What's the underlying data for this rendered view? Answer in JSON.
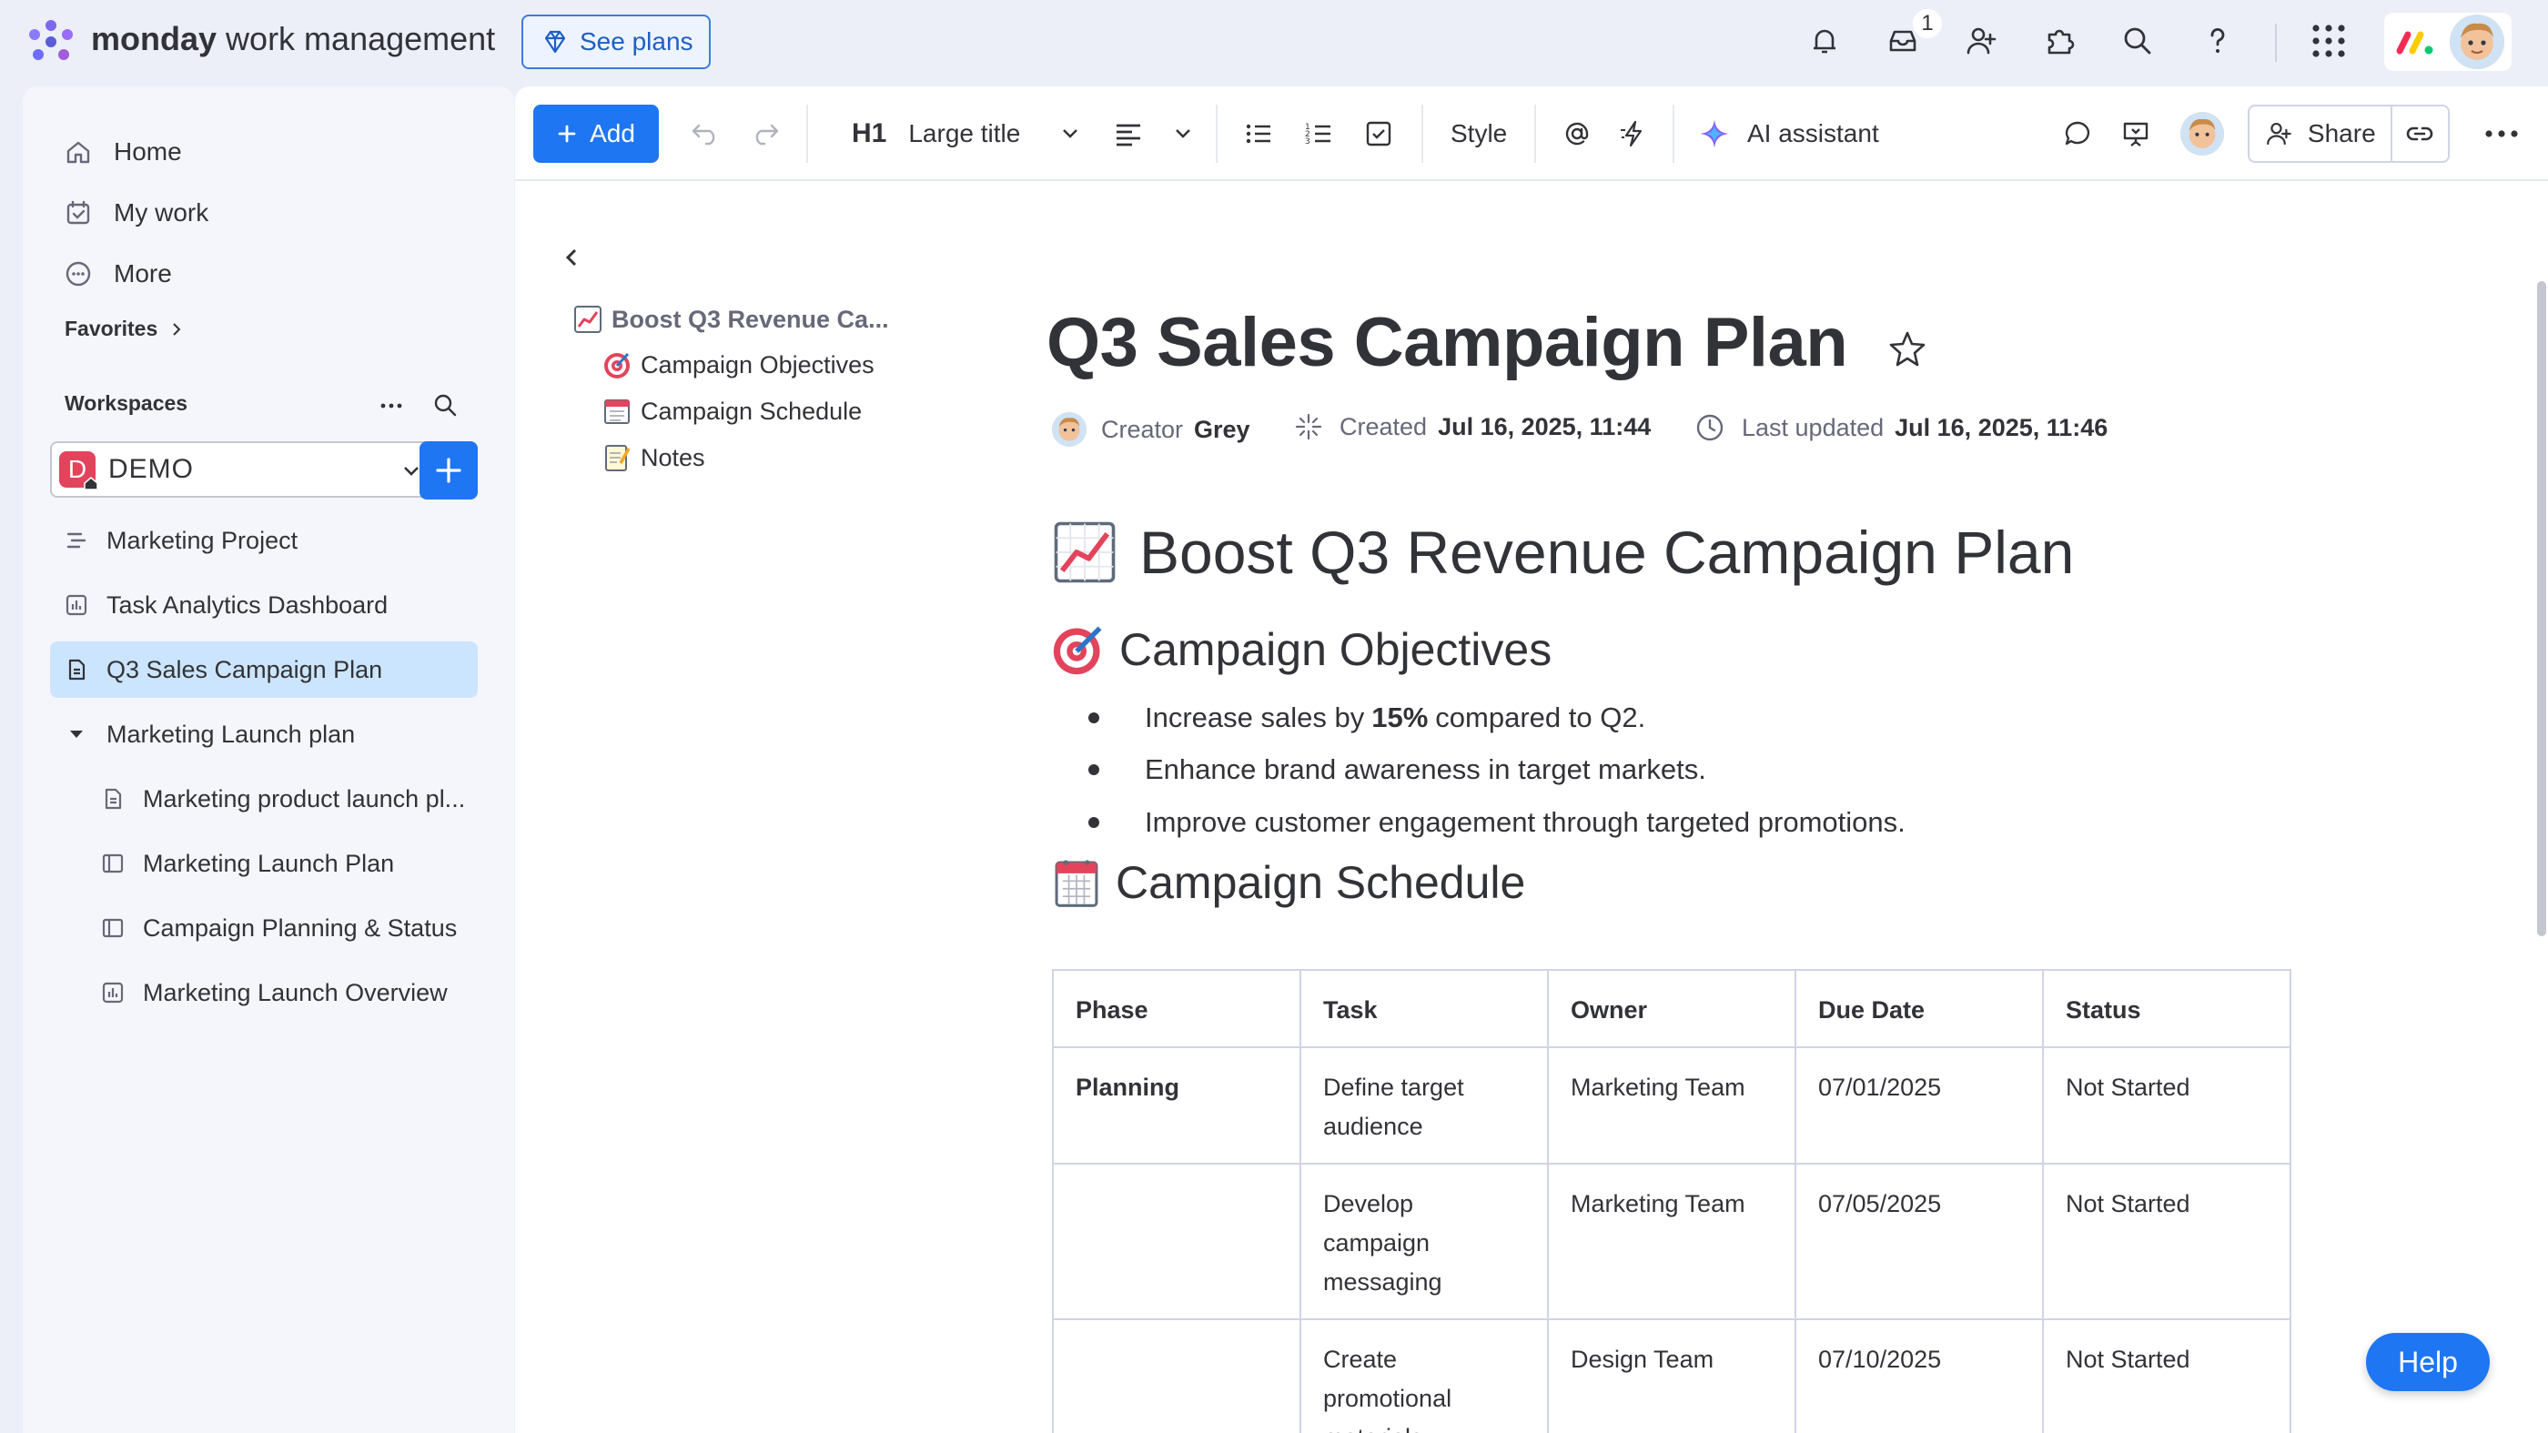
{
  "brand": {
    "name_bold": "monday",
    "name_rest": "work management"
  },
  "top": {
    "see_plans": "See plans",
    "inbox_badge": "1"
  },
  "sidebar": {
    "nav": [
      {
        "label": "Home",
        "icon": "home-icon"
      },
      {
        "label": "My work",
        "icon": "calendar-check-icon"
      },
      {
        "label": "More",
        "icon": "more-circle-icon"
      }
    ],
    "favorites": "Favorites",
    "workspaces": "Workspaces",
    "workspace_logo": "D",
    "workspace_name": "DEMO",
    "items": [
      {
        "label": "Marketing Project",
        "icon": "project-icon"
      },
      {
        "label": "Task Analytics Dashboard",
        "icon": "dashboard-icon"
      },
      {
        "label": "Q3 Sales Campaign Plan",
        "icon": "doc-icon"
      },
      {
        "label": "Marketing Launch plan",
        "icon": "chevron-down-icon"
      },
      {
        "label": "Marketing product launch pl...",
        "icon": "doc-icon"
      },
      {
        "label": "Marketing Launch Plan",
        "icon": "board-icon"
      },
      {
        "label": "Campaign Planning & Status",
        "icon": "board-icon"
      },
      {
        "label": "Marketing Launch Overview",
        "icon": "dashboard-icon"
      }
    ]
  },
  "toolbar": {
    "add": "Add",
    "heading_marker": "H1",
    "heading_style": "Large title",
    "style": "Style",
    "ai": "AI assistant",
    "share": "Share"
  },
  "outline": [
    {
      "emoji": "chart-increasing-emoji",
      "label": "Boost Q3 Revenue Ca..."
    },
    {
      "emoji": "target-emoji",
      "label": "Campaign Objectives"
    },
    {
      "emoji": "calendar-emoji",
      "label": "Campaign Schedule"
    },
    {
      "emoji": "memo-emoji",
      "label": "Notes"
    }
  ],
  "doc": {
    "title": "Q3 Sales Campaign Plan",
    "creator_label": "Creator",
    "creator": "Grey",
    "created_label": "Created",
    "created": "Jul 16, 2025, 11:44",
    "updated_label": "Last updated",
    "updated": "Jul 16, 2025, 11:46",
    "h1": "Boost Q3 Revenue Campaign Plan",
    "objectives_heading": "Campaign Objectives",
    "objectives": {
      "b1_pre": "Increase sales by",
      "b1_bold": "15%",
      "b1_post": "compared to Q2.",
      "b2": "Enhance brand awareness in target markets.",
      "b3": "Improve customer engagement through targeted promotions."
    },
    "schedule_heading": "Campaign Schedule",
    "table": {
      "headers": [
        "Phase",
        "Task",
        "Owner",
        "Due Date",
        "Status"
      ],
      "rows": [
        [
          "Planning",
          "Define target audience",
          "Marketing Team",
          "07/01/2025",
          "Not Started"
        ],
        [
          "",
          "Develop campaign messaging",
          "Marketing Team",
          "07/05/2025",
          "Not Started"
        ],
        [
          "",
          "Create promotional materials",
          "Design Team",
          "07/10/2025",
          "Not Started"
        ]
      ]
    }
  },
  "help": "Help",
  "colors": {
    "accent": "#1f76f2",
    "active_item": "#cce5ff",
    "workspace_logo": "#e2445c"
  }
}
